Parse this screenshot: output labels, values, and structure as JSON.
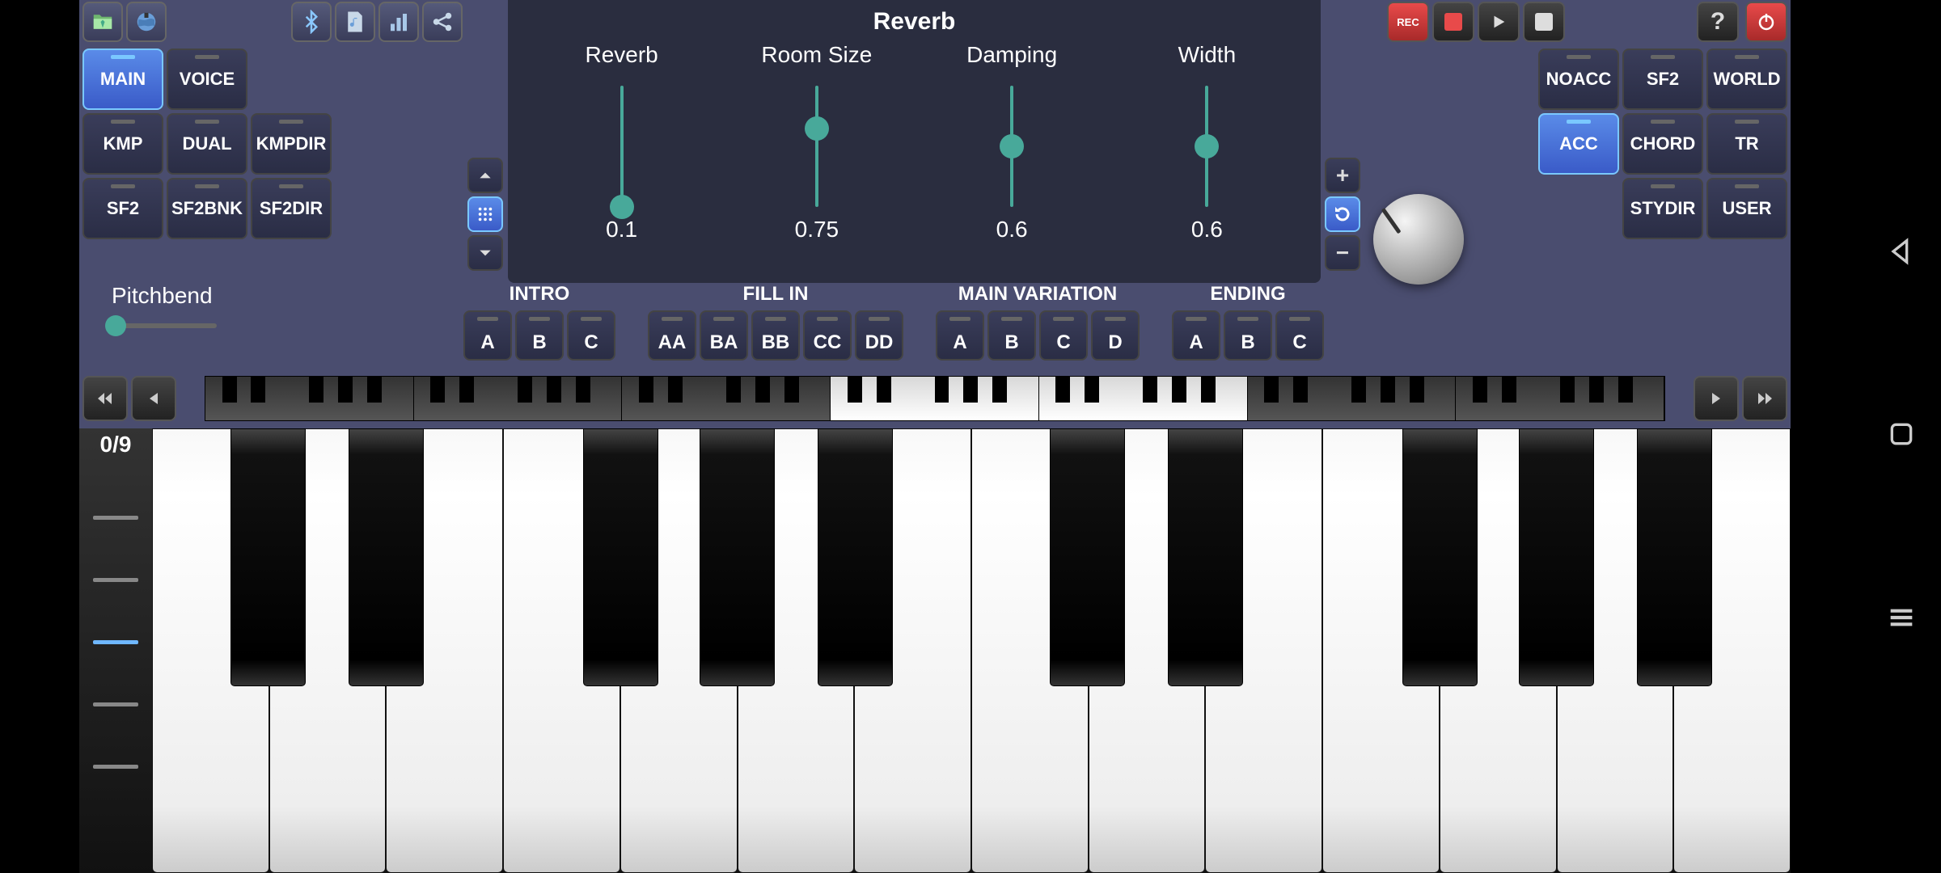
{
  "reverb_panel": {
    "title": "Reverb",
    "sliders": [
      {
        "label": "Reverb",
        "value": "0.1",
        "pos": 0.9
      },
      {
        "label": "Room Size",
        "value": "0.75",
        "pos": 0.25
      },
      {
        "label": "Damping",
        "value": "0.6",
        "pos": 0.4
      },
      {
        "label": "Width",
        "value": "0.6",
        "pos": 0.4
      }
    ]
  },
  "left_tabs": [
    {
      "label": "MAIN",
      "active": true
    },
    {
      "label": "VOICE",
      "active": false
    },
    {
      "label": "",
      "active": false,
      "empty": true
    },
    {
      "label": "KMP",
      "active": false
    },
    {
      "label": "DUAL",
      "active": false
    },
    {
      "label": "KMPDIR",
      "active": false
    },
    {
      "label": "SF2",
      "active": false
    },
    {
      "label": "SF2BNK",
      "active": false
    },
    {
      "label": "SF2DIR",
      "active": false
    }
  ],
  "right_tabs": [
    {
      "label": "NOACC",
      "active": false
    },
    {
      "label": "SF2",
      "active": false
    },
    {
      "label": "WORLD",
      "active": false
    },
    {
      "label": "ACC",
      "active": true
    },
    {
      "label": "CHORD",
      "active": false
    },
    {
      "label": "TR",
      "active": false
    },
    {
      "label": "",
      "active": false,
      "empty": true
    },
    {
      "label": "STYDIR",
      "active": false
    },
    {
      "label": "USER",
      "active": false
    }
  ],
  "pitchbend": {
    "label": "Pitchbend",
    "pos": 0.0
  },
  "style_sections": [
    {
      "title": "INTRO",
      "buttons": [
        "A",
        "B",
        "C"
      ]
    },
    {
      "title": "FILL IN",
      "buttons": [
        "AA",
        "BA",
        "BB",
        "CC",
        "DD"
      ]
    },
    {
      "title": "MAIN VARIATION",
      "buttons": [
        "A",
        "B",
        "C",
        "D"
      ]
    },
    {
      "title": "ENDING",
      "buttons": [
        "A",
        "B",
        "C"
      ]
    }
  ],
  "transport": {
    "rec_label": "REC"
  },
  "velocity": {
    "label": "0/9",
    "active_index": 2
  },
  "keyboard": {
    "white_key_count": 14,
    "black_key_positions": [
      0.071,
      0.143,
      0.286,
      0.357,
      0.429,
      0.571,
      0.643,
      0.786,
      0.857,
      0.929
    ],
    "minimap_octaves": 7,
    "minimap_highlight": [
      3,
      4
    ]
  },
  "top_icons": {
    "left": [
      "folder-icon",
      "globe-icon"
    ],
    "mid": [
      "bluetooth-icon",
      "music-file-icon",
      "equalizer-icon",
      "share-icon"
    ],
    "right": [
      "help-icon",
      "power-icon"
    ]
  }
}
